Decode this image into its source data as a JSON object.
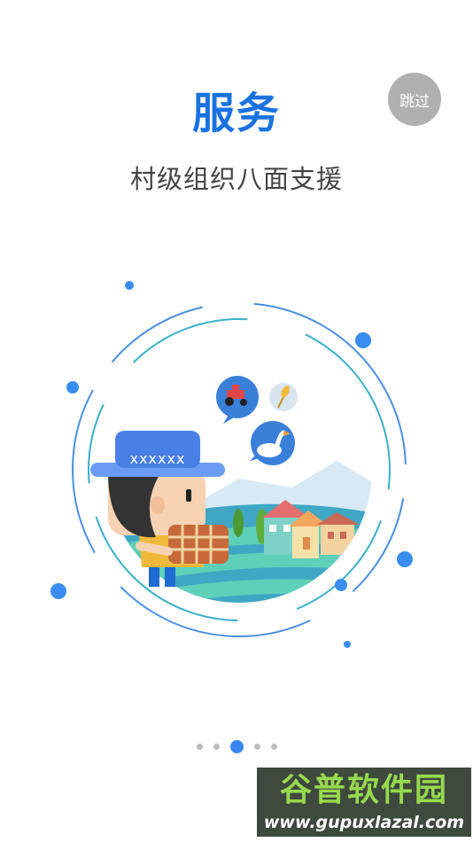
{
  "onboarding": {
    "title": "服务",
    "subtitle": "村级组织八面支援",
    "skip_label": "跳过",
    "hat_pattern": "xxxxxx",
    "pager": {
      "total": 5,
      "active_index": 2
    }
  },
  "watermark": {
    "name": "谷普软件园",
    "url": "www.gupuxlazal.com"
  },
  "colors": {
    "title": "#1a72e0",
    "subtitle": "#444444",
    "skip_bg": "#b0b0b0",
    "dot_active": "#3a86f0",
    "dot_inactive": "#bdbdbd",
    "watermark_bg": "#3d4a3d",
    "watermark_text": "#98d94e"
  },
  "icons": {
    "tractor": "tractor-icon",
    "wheat": "wheat-icon",
    "goose": "goose-icon"
  }
}
